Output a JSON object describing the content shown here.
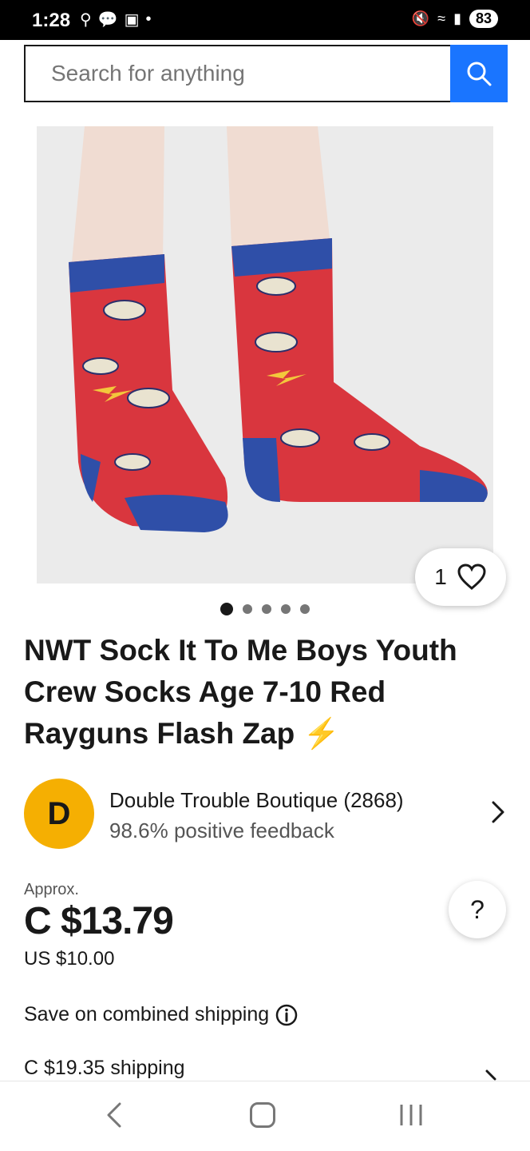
{
  "status_bar": {
    "time": "1:28",
    "battery": "83",
    "icons": [
      "usb-icon",
      "chat-icon",
      "screenshot-icon",
      "dot-icon",
      "mute-icon",
      "wifi-icon",
      "signal-icon"
    ]
  },
  "search": {
    "placeholder": "Search for anything",
    "button_icon": "search-icon"
  },
  "gallery": {
    "photo_icon": "product-photo-socks",
    "image_count": 5,
    "active_index": 0,
    "watch_count": "1"
  },
  "listing": {
    "title": "NWT Sock It To Me Boys Youth Crew Socks Age 7-10 Red Rayguns Flash Zap",
    "title_emoji": "⚡"
  },
  "seller": {
    "avatar_letter": "D",
    "name": "Double Trouble Boutique (2868)",
    "feedback": "98.6% positive feedback"
  },
  "price": {
    "approx_label": "Approx.",
    "main": "C $13.79",
    "original": "US $10.00",
    "help_label": "?"
  },
  "shipping": {
    "combined_label": "Save on combined shipping",
    "cost": "C $19.35 shipping"
  },
  "colors": {
    "accent": "#1a75ff",
    "avatar": "#f5af02",
    "sock_red": "#d9363e",
    "sock_blue": "#2f4fa8"
  }
}
